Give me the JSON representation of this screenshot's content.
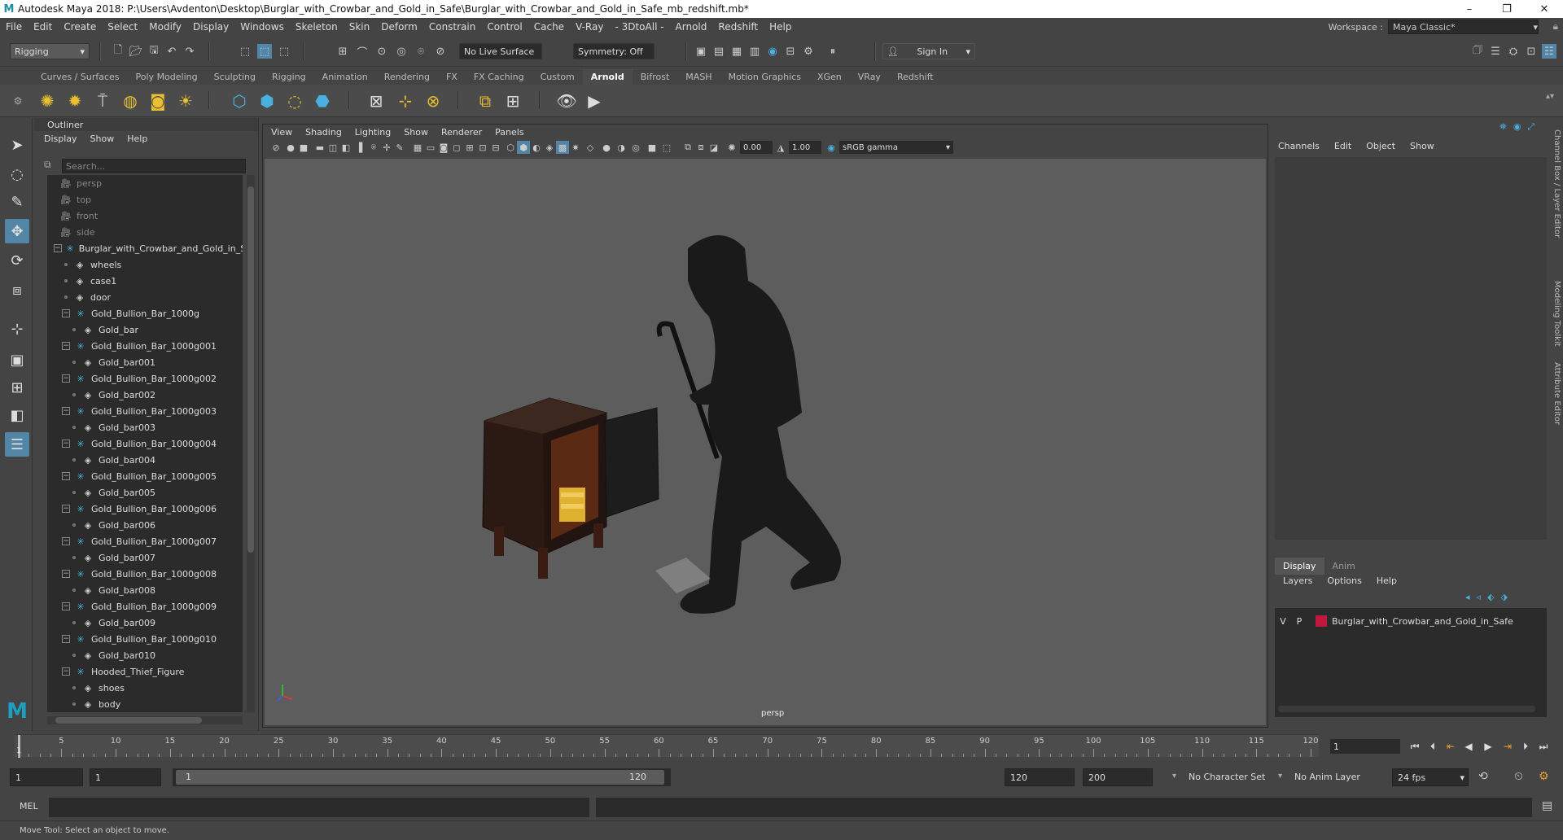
{
  "window": {
    "title": "Autodesk Maya 2018: P:\\Users\\Avdenton\\Desktop\\Burglar_with_Crowbar_and_Gold_in_Safe\\Burglar_with_Crowbar_and_Gold_in_Safe_mb_redshift.mb*",
    "logo": "M",
    "minimize": "–",
    "restore": "❐",
    "close": "✕"
  },
  "menubar": {
    "items": [
      "File",
      "Edit",
      "Create",
      "Select",
      "Modify",
      "Display",
      "Windows",
      "Skeleton",
      "Skin",
      "Deform",
      "Constrain",
      "Control",
      "Cache",
      "V-Ray",
      "- 3DtoAll -",
      "Arnold",
      "Redshift",
      "Help"
    ],
    "workspace_label": "Workspace :",
    "workspace_value": "Maya Classic*"
  },
  "statusline": {
    "menuset": "Rigging",
    "live_surface": "No Live Surface",
    "symmetry": "Symmetry: Off",
    "sign_in": "Sign In"
  },
  "shelf": {
    "tabs": [
      "Curves / Surfaces",
      "Poly Modeling",
      "Sculpting",
      "Rigging",
      "Animation",
      "Rendering",
      "FX",
      "FX Caching",
      "Custom",
      "Arnold",
      "Bifrost",
      "MASH",
      "Motion Graphics",
      "XGen",
      "VRay",
      "Redshift"
    ],
    "active_tab": "Arnold"
  },
  "outliner": {
    "title": "Outliner",
    "menu": [
      "Display",
      "Show",
      "Help"
    ],
    "search_placeholder": "Search...",
    "rows": [
      {
        "label": "persp",
        "kind": "camera",
        "indent": 0,
        "dim": true
      },
      {
        "label": "top",
        "kind": "camera",
        "indent": 0,
        "dim": true
      },
      {
        "label": "front",
        "kind": "camera",
        "indent": 0,
        "dim": true
      },
      {
        "label": "side",
        "kind": "camera",
        "indent": 0,
        "dim": true
      },
      {
        "label": "Burglar_with_Crowbar_and_Gold_in_Sa",
        "kind": "group",
        "indent": 0,
        "expanded": true
      },
      {
        "label": "wheels",
        "kind": "mesh",
        "indent": 1
      },
      {
        "label": "case1",
        "kind": "mesh",
        "indent": 1
      },
      {
        "label": "door",
        "kind": "mesh",
        "indent": 1
      },
      {
        "label": "Gold_Bullion_Bar_1000g",
        "kind": "group",
        "indent": 1,
        "expanded": true
      },
      {
        "label": "Gold_bar",
        "kind": "mesh",
        "indent": 2
      },
      {
        "label": "Gold_Bullion_Bar_1000g001",
        "kind": "group",
        "indent": 1,
        "expanded": true
      },
      {
        "label": "Gold_bar001",
        "kind": "mesh",
        "indent": 2
      },
      {
        "label": "Gold_Bullion_Bar_1000g002",
        "kind": "group",
        "indent": 1,
        "expanded": true
      },
      {
        "label": "Gold_bar002",
        "kind": "mesh",
        "indent": 2
      },
      {
        "label": "Gold_Bullion_Bar_1000g003",
        "kind": "group",
        "indent": 1,
        "expanded": true
      },
      {
        "label": "Gold_bar003",
        "kind": "mesh",
        "indent": 2
      },
      {
        "label": "Gold_Bullion_Bar_1000g004",
        "kind": "group",
        "indent": 1,
        "expanded": true
      },
      {
        "label": "Gold_bar004",
        "kind": "mesh",
        "indent": 2
      },
      {
        "label": "Gold_Bullion_Bar_1000g005",
        "kind": "group",
        "indent": 1,
        "expanded": true
      },
      {
        "label": "Gold_bar005",
        "kind": "mesh",
        "indent": 2
      },
      {
        "label": "Gold_Bullion_Bar_1000g006",
        "kind": "group",
        "indent": 1,
        "expanded": true
      },
      {
        "label": "Gold_bar006",
        "kind": "mesh",
        "indent": 2
      },
      {
        "label": "Gold_Bullion_Bar_1000g007",
        "kind": "group",
        "indent": 1,
        "expanded": true
      },
      {
        "label": "Gold_bar007",
        "kind": "mesh",
        "indent": 2
      },
      {
        "label": "Gold_Bullion_Bar_1000g008",
        "kind": "group",
        "indent": 1,
        "expanded": true
      },
      {
        "label": "Gold_bar008",
        "kind": "mesh",
        "indent": 2
      },
      {
        "label": "Gold_Bullion_Bar_1000g009",
        "kind": "group",
        "indent": 1,
        "expanded": true
      },
      {
        "label": "Gold_bar009",
        "kind": "mesh",
        "indent": 2
      },
      {
        "label": "Gold_Bullion_Bar_1000g010",
        "kind": "group",
        "indent": 1,
        "expanded": true
      },
      {
        "label": "Gold_bar010",
        "kind": "mesh",
        "indent": 2
      },
      {
        "label": "Hooded_Thief_Figure",
        "kind": "group",
        "indent": 1,
        "expanded": true
      },
      {
        "label": "shoes",
        "kind": "mesh",
        "indent": 2
      },
      {
        "label": "body",
        "kind": "mesh",
        "indent": 2
      }
    ]
  },
  "viewport": {
    "menu": [
      "View",
      "Shading",
      "Lighting",
      "Show",
      "Renderer",
      "Panels"
    ],
    "near_value": "0.00",
    "far_value": "1.00",
    "color_space": "sRGB gamma",
    "camera_label": "persp",
    "colors": {
      "background": "#5d5d5d",
      "safe_frame": "#2b1a14",
      "gold": "#e0b030",
      "figure": "#1a1a1a"
    }
  },
  "channelbox": {
    "menu": [
      "Channels",
      "Edit",
      "Object",
      "Show"
    ],
    "layer_tabs": [
      "Display",
      "Anim"
    ],
    "active_layer_tab": "Display",
    "layer_menu": [
      "Layers",
      "Options",
      "Help"
    ],
    "layer": {
      "v": "V",
      "p": "P",
      "name": "Burglar_with_Crowbar_and_Gold_in_Safe",
      "color": "#c0173f"
    },
    "side_tabs": [
      "Channel Box / Layer Editor",
      "Modeling Toolkit",
      "Attribute Editor"
    ]
  },
  "timeline": {
    "ticks": [
      5,
      10,
      15,
      20,
      25,
      30,
      35,
      40,
      45,
      50,
      55,
      60,
      65,
      70,
      75,
      80,
      85,
      90,
      95,
      100,
      105,
      110,
      115,
      120
    ],
    "current_frame_marker": "1",
    "current_frame": "1"
  },
  "range": {
    "start": "1",
    "playback_start": "1",
    "handle_start": "1",
    "handle_end": "120",
    "playback_end": "120",
    "end": "200",
    "character_set": "No Character Set",
    "anim_layer": "No Anim Layer",
    "fps": "24 fps"
  },
  "cmdline": {
    "label": "MEL"
  },
  "helpline": {
    "text": "Move Tool: Select an object to move."
  }
}
